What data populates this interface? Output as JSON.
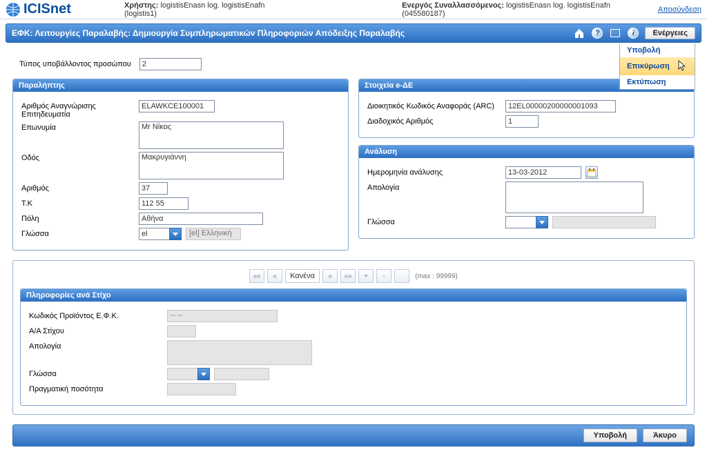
{
  "brand": "ICISnet",
  "topbar": {
    "user_label": "Χρήστης:",
    "user_value": "logistisEnasn log. logistisEnafn (logistis1)",
    "active_label": "Ενεργός Συναλλασσόμενος:",
    "active_value": "logistisEnasn log. logistisEnafn (045580187)",
    "logout": "Αποσύνδεση"
  },
  "header": {
    "title": "ΕΦΚ: Λειτουργίες Παραλαβής: Δημιουργία Συμπληρωματικών Πληροφοριών Απόδειξης Παραλαβής",
    "actions_button": "Ενέργειες",
    "menu": {
      "submit": "Υποβολή",
      "validate": "Επικύρωση",
      "print": "Εκτύπωση"
    }
  },
  "submitter": {
    "label": "Τύπος υποβάλλοντος προσώπου",
    "value": "2"
  },
  "recipient": {
    "title": "Παραλήπτης",
    "trader_id_label": "Αριθμός Αναγνώρισης Επιτηδευματία",
    "trader_id": "ELAWKCE100001",
    "name_label": "Επωνυμία",
    "name": "Mr Νίκος",
    "street_label": "Οδός",
    "street": "Μακρυγιάννη",
    "number_label": "Αριθμός",
    "number": "37",
    "zip_label": "Τ.Κ",
    "zip": "112 55",
    "city_label": "Πόλη",
    "city": "Αθήνα",
    "lang_label": "Γλώσσα",
    "lang": "el",
    "lang_display": "[el] Ελληνική"
  },
  "ede": {
    "title": "Στοιχεία e-ΔΕ",
    "arc_label": "Διοικητικός Κωδικός Αναφοράς (ARC)",
    "arc": "12EL00000200000001093",
    "seq_label": "Διαδοχικός Αριθμός",
    "seq": "1"
  },
  "analysis": {
    "title": "Ανάλυση",
    "date_label": "Ημερομηνία ανάλυσης",
    "date": "13-03-2012",
    "justification_label": "Απολογία",
    "justification": "",
    "lang_label": "Γλώσσα",
    "lang": "",
    "lang_display": ""
  },
  "pager": {
    "none": "Κανένα",
    "plus": "+",
    "minus": "-",
    "max": "(max : 99999)"
  },
  "line_info": {
    "title": "Πληροφορίες ανά Στίχο",
    "product_label": "Κωδικός Προϊόντος Ε.Φ.Κ.",
    "product": "-- --",
    "aa_label": "Α/Α Στίχου",
    "justification_label": "Απολογία",
    "lang_label": "Γλώσσα",
    "qty_label": "Πραγματική ποσότητα"
  },
  "footer": {
    "submit": "Υποβολή",
    "cancel": "Άκυρο"
  }
}
